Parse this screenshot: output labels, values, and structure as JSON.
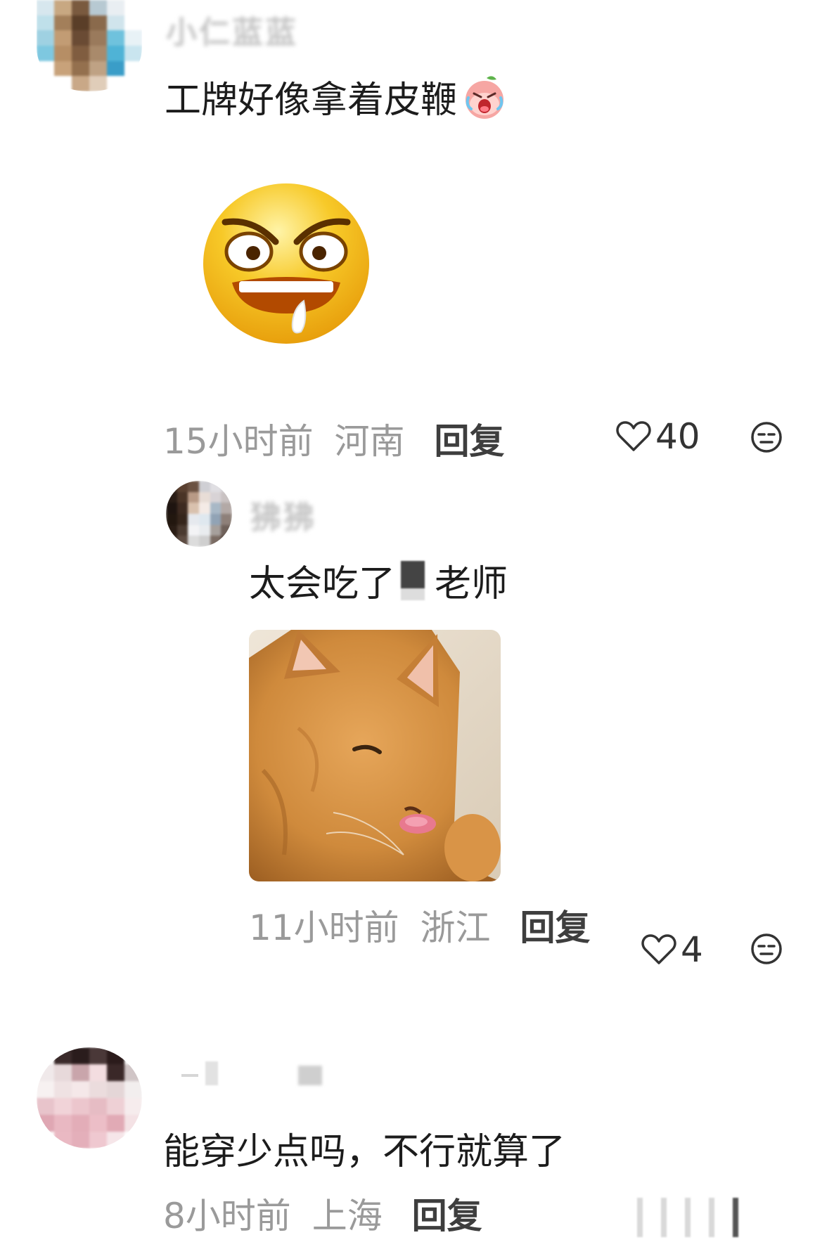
{
  "comments": [
    {
      "username": "小仁蓝蓝",
      "text": "工牌好像拿着皮鞭",
      "emoji_inline": "crying-peach-emoji",
      "sticker": "angry-drooling-face-sticker",
      "time": "15小时前",
      "location": "河南",
      "reply_label": "回复",
      "likes": "40",
      "icons": {
        "like": "heart-outline-icon",
        "dislike": "meh-face-icon"
      }
    },
    {
      "username": "狒狒",
      "text_before": "太会吃了",
      "text_after": "老师",
      "image": "orange-cat-licking-photo",
      "time": "11小时前",
      "location": "浙江",
      "reply_label": "回复",
      "likes": "4",
      "icons": {
        "like": "heart-outline-icon",
        "dislike": "meh-face-icon"
      }
    },
    {
      "username": "",
      "text": "能穿少点吗，不行就算了",
      "time": "8小时前",
      "location": "上海",
      "reply_label": "回复"
    }
  ],
  "colors": {
    "meta_gray": "#9a9a9a",
    "reply_dark": "#3e3e3e",
    "text": "#1c1c1c",
    "emoji_yellow": "#f7b816"
  }
}
